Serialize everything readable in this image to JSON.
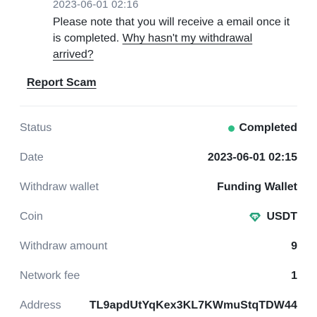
{
  "timeline": {
    "timestamp": "2023-06-01 02:16",
    "note": "Please note that you will receive a email once it is completed.",
    "note_link": "Why hasn't my withdrawal arrived?"
  },
  "report_label": "Report Scam",
  "status_color": "#2ebd85",
  "coin_icon_color": "#26a17b",
  "details": {
    "status": {
      "label": "Status",
      "value": "Completed"
    },
    "date": {
      "label": "Date",
      "value": "2023-06-01 02:15"
    },
    "wallet": {
      "label": "Withdraw wallet",
      "value": "Funding Wallet"
    },
    "coin": {
      "label": "Coin",
      "value": "USDT",
      "icon": "tether-icon"
    },
    "amount": {
      "label": "Withdraw amount",
      "value": "9"
    },
    "fee": {
      "label": "Network fee",
      "value": "1"
    },
    "address": {
      "label": "Address",
      "value": "TL9apdUtYqKex3KL7KWmuStqTDW44"
    }
  }
}
